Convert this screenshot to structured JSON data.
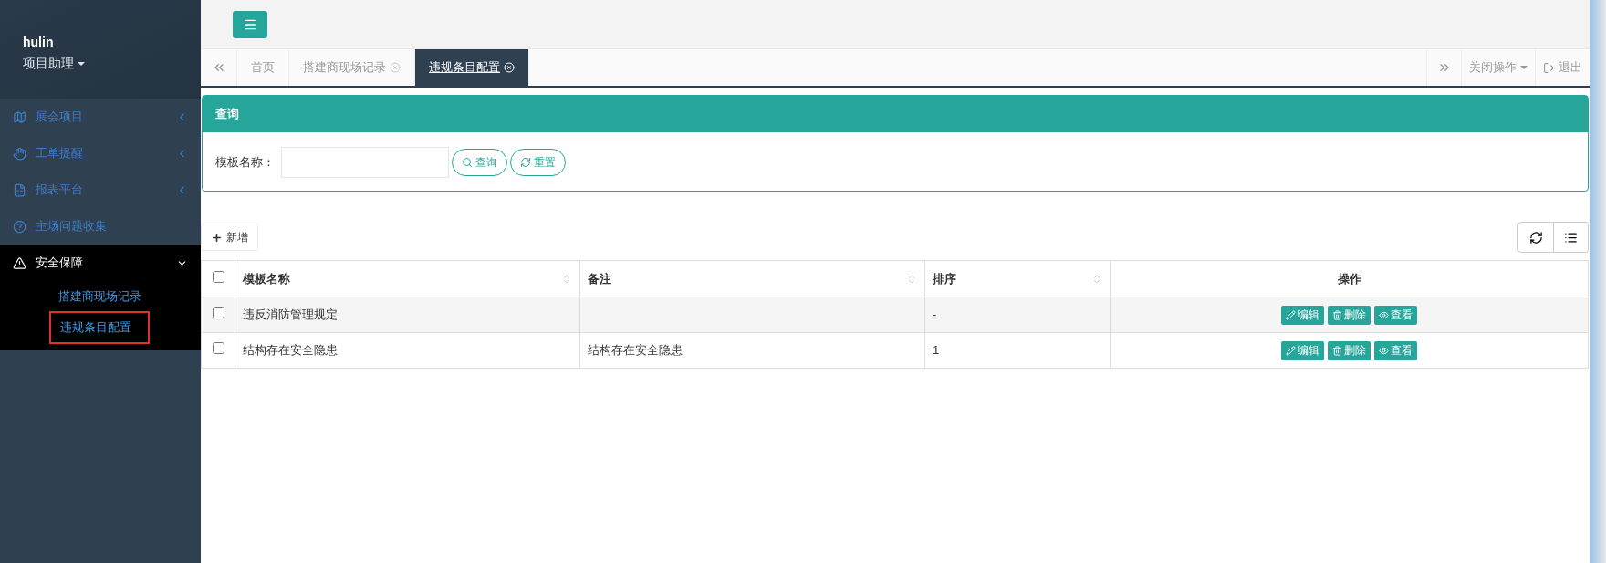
{
  "sidebar": {
    "user": {
      "name": "hulin",
      "role": "项目助理"
    },
    "items": [
      {
        "kind": "map",
        "label": "展会项目",
        "expanded": false,
        "has_children": true
      },
      {
        "kind": "hand",
        "label": "工单提醒",
        "expanded": false,
        "has_children": true
      },
      {
        "kind": "spreadsheet",
        "label": "报表平台",
        "expanded": false,
        "has_children": true
      },
      {
        "kind": "help",
        "label": "主场问题收集",
        "expanded": false,
        "has_children": false
      },
      {
        "kind": "warning",
        "label": "安全保障",
        "expanded": true,
        "has_children": true,
        "children": [
          {
            "label": "搭建商现场记录",
            "selected": false
          },
          {
            "label": "违规条目配置",
            "selected": true
          }
        ]
      }
    ]
  },
  "tabs": [
    {
      "label": "首页",
      "selected": false,
      "closable": false
    },
    {
      "label": "搭建商现场记录",
      "selected": false,
      "closable": true
    },
    {
      "label": "违规条目配置",
      "selected": true,
      "closable": true
    }
  ],
  "tab_actions": {
    "close_menu": "关闭操作",
    "logout": "退出"
  },
  "query": {
    "title": "查询",
    "field_label": "模板名称：",
    "buttons": [
      {
        "kind": "search",
        "label": "查询"
      },
      {
        "kind": "reset",
        "label": "重置"
      }
    ]
  },
  "toolbar": {
    "add": "新增"
  },
  "table": {
    "select_all_checked": false,
    "columns": [
      {
        "label": "模板名称",
        "sortable": true
      },
      {
        "label": "备注",
        "sortable": true
      },
      {
        "label": "排序",
        "sortable": true
      },
      {
        "label": "操作",
        "sortable": false
      }
    ],
    "rows": [
      {
        "checked": false,
        "cells": [
          "违反消防管理规定",
          "",
          "-"
        ],
        "actions": [
          {
            "kind": "edit",
            "label": "编辑"
          },
          {
            "kind": "delete",
            "label": "删除"
          },
          {
            "kind": "view",
            "label": "查看"
          }
        ]
      },
      {
        "checked": false,
        "cells": [
          "结构存在安全隐患",
          "结构存在安全隐患",
          "1"
        ],
        "actions": [
          {
            "kind": "edit",
            "label": "编辑"
          },
          {
            "kind": "delete",
            "label": "删除"
          },
          {
            "kind": "view",
            "label": "查看"
          }
        ]
      }
    ]
  }
}
